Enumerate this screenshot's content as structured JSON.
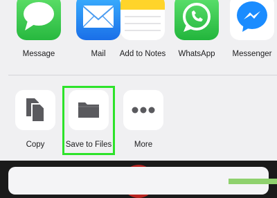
{
  "apps": [
    {
      "label": "Message",
      "icon": "messages-icon",
      "color": "#34c759"
    },
    {
      "label": "Mail",
      "icon": "mail-icon",
      "color": "#1e88f5"
    },
    {
      "label": "Add to Notes",
      "icon": "notes-icon",
      "color": "#ffd42a"
    },
    {
      "label": "WhatsApp",
      "icon": "whatsapp-icon",
      "color": "#2bc64a"
    },
    {
      "label": "Messenger",
      "icon": "messenger-icon",
      "color": "#1a8cff"
    }
  ],
  "actions": [
    {
      "label": "Copy",
      "icon": "copy-icon"
    },
    {
      "label": "Save to Files",
      "icon": "folder-icon",
      "highlighted": true
    },
    {
      "label": "More",
      "icon": "more-icon"
    }
  ],
  "colors": {
    "highlight": "#2de32a",
    "sheet_background": "#f0f0f2",
    "glyph": "#5a5a5e"
  }
}
